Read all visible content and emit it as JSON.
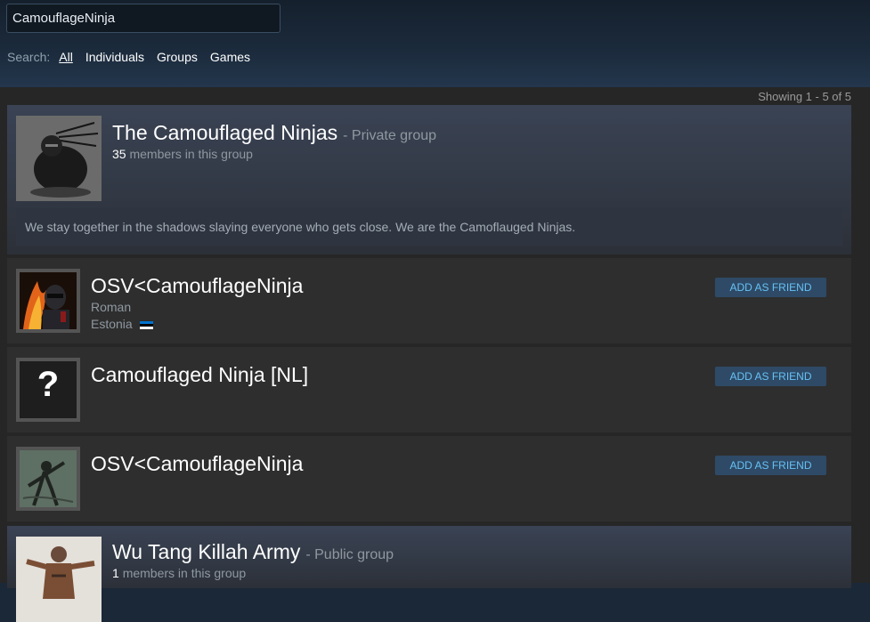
{
  "search": {
    "value": "CamouflageNinja"
  },
  "filters": {
    "label": "Search:",
    "items": [
      "All",
      "Individuals",
      "Groups",
      "Games"
    ],
    "active": "All"
  },
  "results": {
    "showing": "Showing 1 - 5 of 5",
    "group1": {
      "name": "The Camouflaged Ninjas",
      "type": "- Private group",
      "member_count": "35",
      "member_text": "members in this group",
      "description": "We stay together in the shadows slaying everyone who gets close. We are the Camoflauged Ninjas.",
      "avatar_icon": "ninja-avatar-icon"
    },
    "user1": {
      "name": "OSV<CamouflageNinja",
      "real_name": "Roman",
      "location": "Estonia",
      "button": "ADD AS FRIEND",
      "flag_icon": "estonia-flag-icon"
    },
    "user2": {
      "name": "Camouflaged Ninja [NL]",
      "avatar_glyph": "?",
      "button": "ADD AS FRIEND"
    },
    "user3": {
      "name": "OSV<CamouflageNinja",
      "button": "ADD AS FRIEND"
    },
    "group2": {
      "name": "Wu Tang Killah Army",
      "type": "- Public group",
      "member_count": "1",
      "member_text": "members in this group"
    }
  },
  "colors": {
    "accent": "#67c1f5",
    "button_bg": "#2e4a66",
    "header_bg": "#1b2838",
    "card_bg": "#2e2e2e"
  }
}
